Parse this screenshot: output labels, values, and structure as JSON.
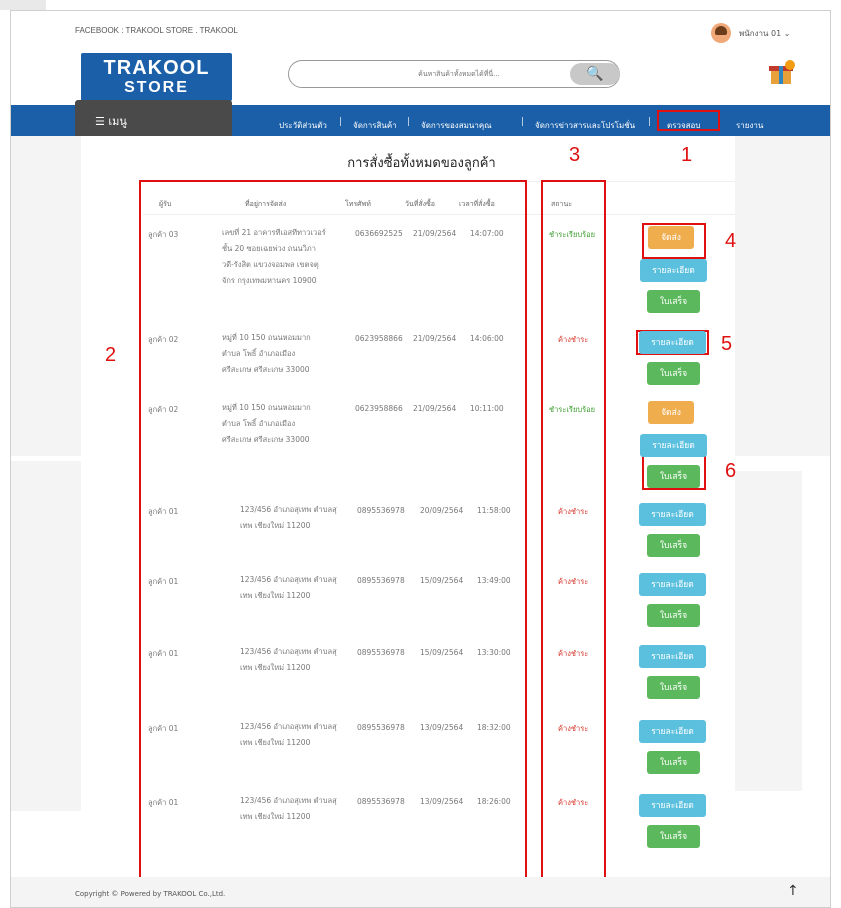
{
  "header": {
    "facebook_text": "FACEBOOK : TRAKOOL STORE . TRAKOOL",
    "user_label": "พนักงาน 01  ⌄",
    "logo_line1": "TRAKOOL",
    "logo_line2": "STORE",
    "search_placeholder": "ค้นหาสินค้าทั้งหมดได้ที่นี่...",
    "search_icon": "🔍",
    "menu_label": "☰  เมนู"
  },
  "nav": {
    "items": [
      "ประวัติส่วนตัว",
      "จัดการสินค้า",
      "จัดการของสมนาคุณ",
      "จัดการข่าวสารและโปรโมชั่น",
      "ตรวจสอบ",
      "รายงาน"
    ],
    "separator": "|"
  },
  "page": {
    "title": "การสั่งซื้อทั้งหมดของลูกค้า"
  },
  "table": {
    "headers": [
      "ผู้รับ",
      "ที่อยู่การจัดส่ง",
      "โทรศัพท์",
      "วันที่สั่งซื้อ",
      "เวลาที่สั่งซื้อ",
      "สถานะ"
    ],
    "rows": [
      {
        "recipient": "ลูกค้า 03",
        "address": "เลขที่ 21 อาคารทีเอสทีทาวเวอร์ ชั้น 20 ซอยเฉยพ่วง ถนนวิภาวดี-รังสิต แขวงจอมพล เขตจตุจักร กรุงเทพมหานคร 10900",
        "phone": "0636692525",
        "date": "21/09/2564",
        "time": "14:07:00",
        "status": "ชำระเรียบร้อย"
      },
      {
        "recipient": "ลูกค้า 02",
        "address": "หมู่ที่ 10 150 ถนนหอมมาก ตำบล โพธิ์ อำเภอเมือง ศรีสะเกษ ศรีสะเกษ 33000",
        "phone": "0623958866",
        "date": "21/09/2564",
        "time": "14:06:00",
        "status": "ค้างชำระ"
      },
      {
        "recipient": "ลูกค้า 02",
        "address": "หมู่ที่ 10 150 ถนนหอมมาก ตำบล โพธิ์ อำเภอเมือง ศรีสะเกษ ศรีสะเกษ 33000",
        "phone": "0623958866",
        "date": "21/09/2564",
        "time": "10:11:00",
        "status": "ชำระเรียบร้อย"
      },
      {
        "recipient": "ลูกค้า 01",
        "address": "123/456 อำเภอสุเทพ ตำบลสุเทพ เชียงใหม่ 11200",
        "phone": "0895536978",
        "date": "20/09/2564",
        "time": "11:58:00",
        "status": "ค้างชำระ"
      },
      {
        "recipient": "ลูกค้า 01",
        "address": "123/456 อำเภอสุเทพ ตำบลสุเทพ เชียงใหม่ 11200",
        "phone": "0895536978",
        "date": "15/09/2564",
        "time": "13:49:00",
        "status": "ค้างชำระ"
      },
      {
        "recipient": "ลูกค้า 01",
        "address": "123/456 อำเภอสุเทพ ตำบลสุเทพ เชียงใหม่ 11200",
        "phone": "0895536978",
        "date": "15/09/2564",
        "time": "13:30:00",
        "status": "ค้างชำระ"
      },
      {
        "recipient": "ลูกค้า 01",
        "address": "123/456 อำเภอสุเทพ ตำบลสุเทพ เชียงใหม่ 11200",
        "phone": "0895536978",
        "date": "13/09/2564",
        "time": "18:32:00",
        "status": "ค้างชำระ"
      },
      {
        "recipient": "ลูกค้า 01",
        "address": "123/456 อำเภอสุเทพ ตำบลสุเทพ เชียงใหม่ 11200",
        "phone": "0895536978",
        "date": "13/09/2564",
        "time": "18:26:00",
        "status": "ค้างชำระ"
      }
    ],
    "address_lines": [
      [
        "เลขที่ 21 อาคารทีเอสทีทาวเวอร์",
        "ชั้น 20 ซอยเฉยพ่วง ถนนวิภา",
        "วดี-รังสิต แขวงจอมพล เขตจตุ",
        "จักร กรุงเทพมหานคร 10900"
      ],
      [
        "หมู่ที่ 10 150 ถนนหอมมาก",
        "ตำบล โพธิ์ อำเภอเมือง",
        "ศรีสะเกษ ศรีสะเกษ 33000"
      ],
      [
        "หมู่ที่ 10 150 ถนนหอมมาก",
        "ตำบล โพธิ์ อำเภอเมือง",
        "ศรีสะเกษ ศรีสะเกษ 33000"
      ],
      [
        "123/456 อำเภอสุเทพ ตำบลสุ",
        "เทพ เชียงใหม่ 11200"
      ],
      [
        "123/456 อำเภอสุเทพ ตำบลสุ",
        "เทพ เชียงใหม่ 11200"
      ],
      [
        "123/456 อำเภอสุเทพ ตำบลสุ",
        "เทพ เชียงใหม่ 11200"
      ],
      [
        "123/456 อำเภอสุเทพ ตำบลสุ",
        "เทพ เชียงใหม่ 11200"
      ],
      [
        "123/456 อำเภอสุเทพ ตำบลสุ",
        "เทพ เชียงใหม่ 11200"
      ]
    ]
  },
  "buttons": {
    "ship": "จัดส่ง",
    "details": "รายละเอียด",
    "receipt": "ใบเสร็จ"
  },
  "annotations": {
    "numbers": [
      "1",
      "2",
      "3",
      "4",
      "5",
      "6"
    ],
    "color": "#e01010"
  },
  "footer": {
    "copyright": "Copyright © Powered by TRAKOOL Co.,Ltd.",
    "up_arrow": "↑"
  },
  "colors": {
    "brand_blue": "#1a5fa8",
    "paid_green": "#3c9d2e",
    "due_red": "#d9362a",
    "btn_orange": "#f0ad4e",
    "btn_blue": "#5bc0de",
    "btn_green": "#5cb85c"
  }
}
